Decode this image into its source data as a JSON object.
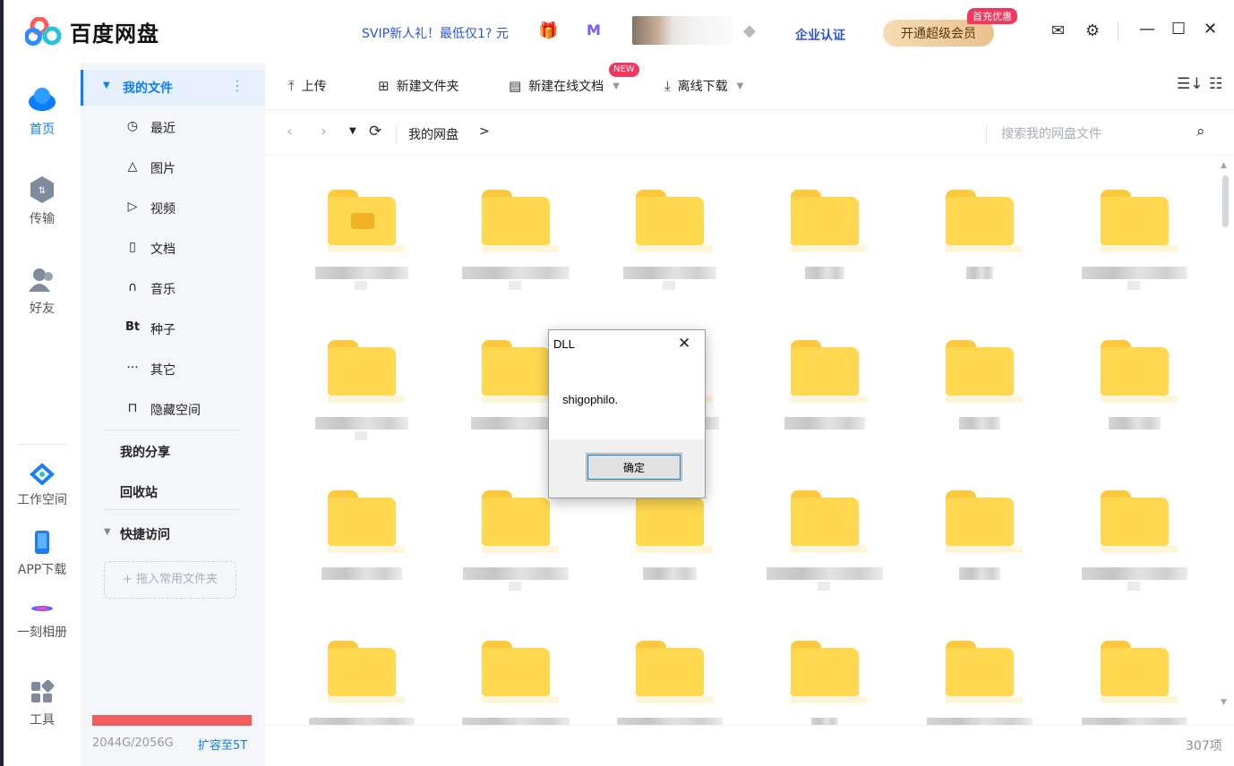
{
  "app": {
    "title": "百度网盘",
    "promo": "SVIP新人礼！最低仅1? 元",
    "enterprise": "企业认证",
    "vip_button": "开通超级会员",
    "first_charge_badge": "首充优惠"
  },
  "rail": {
    "home": "首页",
    "transfer": "传输",
    "friends": "好友",
    "workspace": "工作空间",
    "app_download": "APP下载",
    "album": "一刻相册",
    "tools": "工具"
  },
  "sidebar": {
    "my_files": "我的文件",
    "items": [
      {
        "label": "最近",
        "icon": "clock-icon",
        "glyph": "🕘"
      },
      {
        "label": "图片",
        "icon": "image-icon",
        "glyph": "△"
      },
      {
        "label": "视频",
        "icon": "play-icon",
        "glyph": "▷"
      },
      {
        "label": "文档",
        "icon": "document-icon",
        "glyph": "▯"
      },
      {
        "label": "音乐",
        "icon": "headphones-icon",
        "glyph": "∩"
      },
      {
        "label": "种子",
        "icon": "bt-icon",
        "glyph": "Bt"
      },
      {
        "label": "其它",
        "icon": "more-icon",
        "glyph": "···"
      },
      {
        "label": "隐藏空间",
        "icon": "lock-icon",
        "glyph": "🔒"
      }
    ],
    "my_share": "我的分享",
    "recycle_bin": "回收站",
    "quick_access": "快捷访问",
    "drop_hint": "+ 拖入常用文件夹",
    "storage": "2044G/2056G",
    "storage_used_fraction": 0.994,
    "expand": "扩容至5T"
  },
  "toolbar": {
    "upload": "上传",
    "new_folder": "新建文件夹",
    "new_online_doc": "新建在线文档",
    "new_badge": "NEW",
    "offline_download": "离线下载"
  },
  "pathbar": {
    "crumb": "我的网盘",
    "crumb_sep": ">",
    "search_placeholder": "搜索我的网盘文件"
  },
  "files": {
    "item_count_text": "307项"
  },
  "dialog": {
    "title": "DLL",
    "message": "shigophilo.",
    "ok": "确定"
  },
  "colors": {
    "accent": "#0a7cff",
    "folder": "#ffd84f",
    "storage_bar": "#f25c5c"
  }
}
